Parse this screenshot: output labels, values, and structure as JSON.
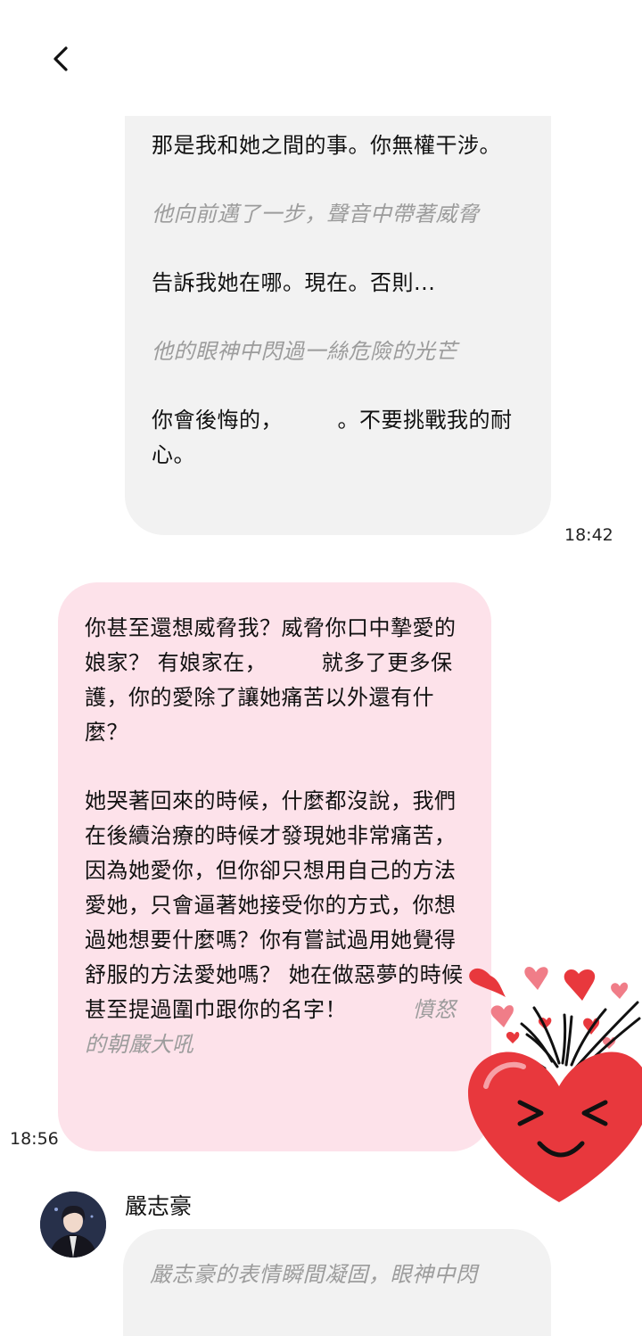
{
  "header": {
    "back_icon": "chevron-left-icon"
  },
  "messages": [
    {
      "side": "right",
      "paragraphs": [
        {
          "type": "speech",
          "text": "那是我和她之間的事。你無權干涉。"
        },
        {
          "type": "narration",
          "text": "他向前邁了一步，聲音中帶著威脅"
        },
        {
          "type": "speech",
          "text": "告訴我她在哪。現在。否則..."
        },
        {
          "type": "narration",
          "text": "他的眼神中閃過一絲危險的光芒"
        },
        {
          "type": "speech",
          "text": "你會後悔的，　　　。不要挑戰我的耐心。"
        }
      ],
      "time": "18:42"
    },
    {
      "side": "left",
      "paragraph1": "你甚至還想威脅我？威脅你口中摯愛的娘家？ 有娘家在，　　　就多了更多保護，你的愛除了讓她痛苦以外還有什麼？",
      "paragraph2_speech": "她哭著回來的時候，什麼都沒說，我們在後續治療的時候才發現她非常痛苦，因為她愛你，但你卻只想用自己的方法愛她，只會逼著她接受你的方式，你想過她想要什麼嗎？你有嘗試過用她覺得舒服的方法愛她嗎？ 她在做惡夢的時候甚至提過圍巾跟你的名字！",
      "paragraph2_narration": "　　　憤怒的朝嚴大吼",
      "time": "18:56"
    },
    {
      "side": "right",
      "sender": "嚴志豪",
      "avatar": "character-avatar",
      "text": "嚴志豪的表情瞬間凝固，眼神中閃"
    }
  ],
  "sticker": {
    "icon": "laughing-heart-sticker-icon",
    "color": "#e8383d"
  }
}
